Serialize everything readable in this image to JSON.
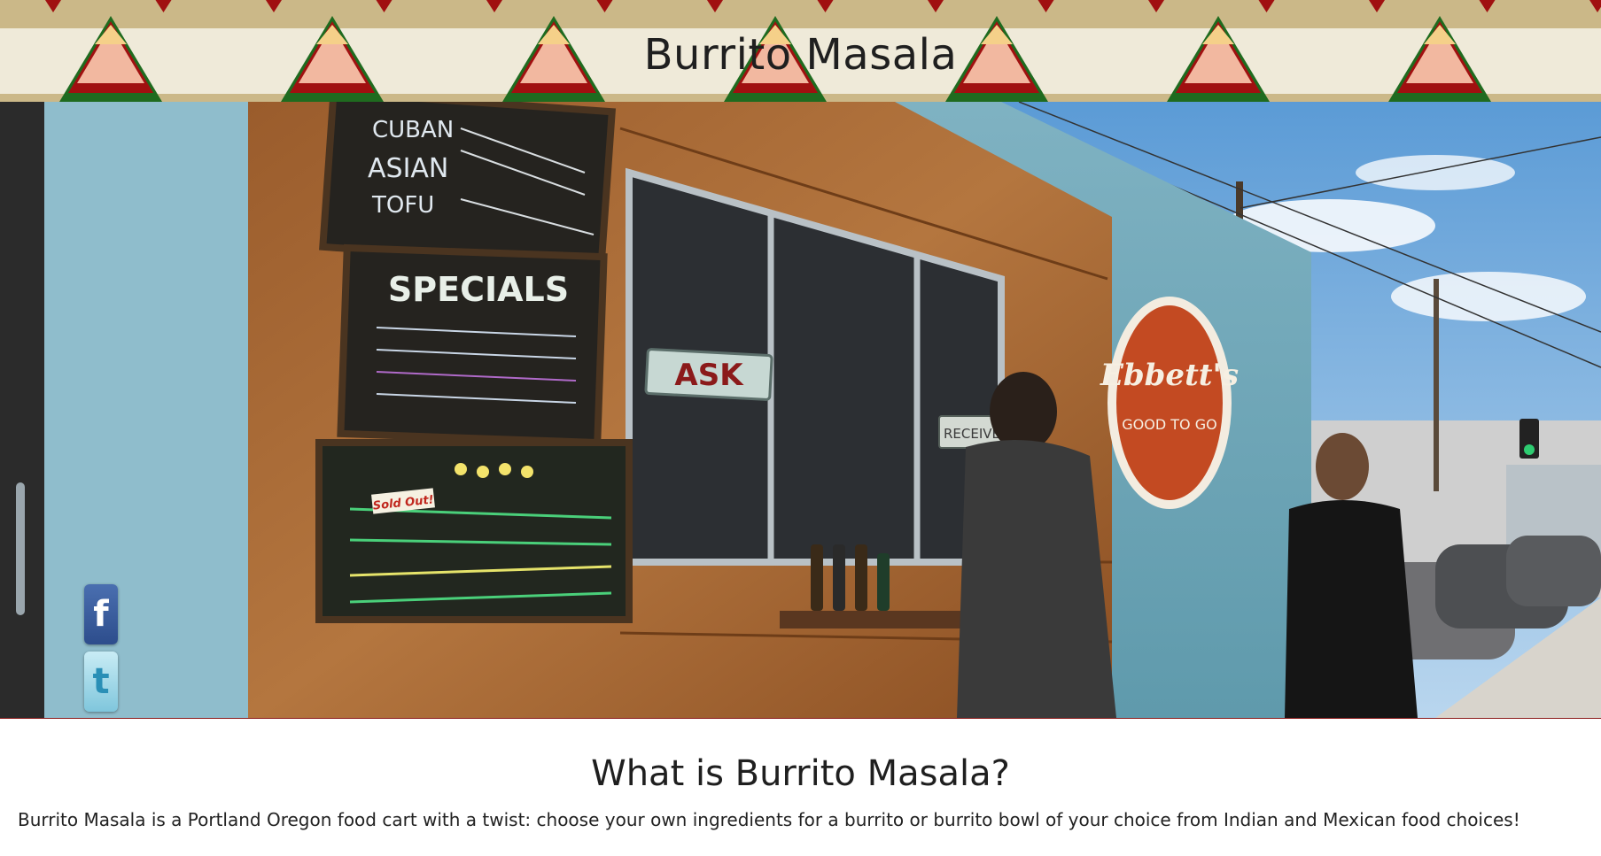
{
  "header": {
    "title": "Burrito Masala"
  },
  "hero": {
    "signs": {
      "ask": "ASK",
      "receive": "RECEIVE",
      "specials": "SPECIALS",
      "truck_brand": "Ebbett's",
      "truck_tagline": "GOOD TO GO",
      "sold_out": "Sold Out!"
    }
  },
  "social": {
    "facebook_glyph": "f",
    "twitter_glyph": "t"
  },
  "about": {
    "heading": "What is Burrito Masala?",
    "text": "Burrito Masala is a Portland Oregon food cart with a twist: choose your own ingredients for a burrito or burrito bowl of your choice from Indian and Mexican food choices!"
  },
  "colors": {
    "banner_top": "#cbb888",
    "banner_mid": "#efead9",
    "triangle_red": "#a01010",
    "triangle_green": "#1f6b1f",
    "triangle_peach": "#f2b8a0",
    "triangle_yellow": "#f5d089"
  }
}
